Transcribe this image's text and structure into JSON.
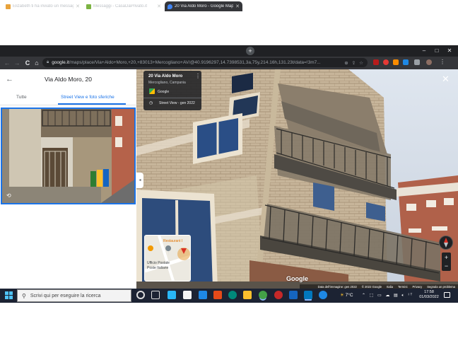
{
  "browser": {
    "tabs": [
      {
        "title": "Elizabeth ti ha inviato un messaggio",
        "active": false
      },
      {
        "title": "Messaggi - CasaDaPrivato.it",
        "active": false
      },
      {
        "title": "20 Via Aldo Moro - Google Maps",
        "active": true
      }
    ],
    "new_tab": "+",
    "minimize": "–",
    "maximize": "□",
    "close": "✕",
    "back": "←",
    "forward": "→",
    "reload": "C",
    "home": "⌂",
    "url_host": "google.it",
    "url_path": "/maps/place/Via+Aldo+Moro,+20,+83013+Mercogliano+AV/@40.9196297,14.7398531,3a,75y,214.16h,131.23t/data=!3m7..."
  },
  "left_panel": {
    "back_icon": "←",
    "title": "Via Aldo Moro, 20",
    "tabs": [
      "Tutte",
      "Street View e foto sferiche"
    ],
    "active_tab": 1,
    "photo_badge": "360"
  },
  "street_view": {
    "card_title": "20 Via Aldo Moro",
    "card_subtitle": "Mercogliano, Campania",
    "card_brand": "Google",
    "card_date": "Street View - gen 2022",
    "card_menu": "⋮",
    "close_icon": "✕",
    "collapse_icon": "◂",
    "minimap_labels": [
      "Restaurant I",
      "Ufficio Postale",
      "Poste Italiane"
    ],
    "zoom_in": "+",
    "zoom_out": "−",
    "google_logo": "Google",
    "attribution": [
      "Data dell'immagine: gen 2022",
      "© 2022 Google",
      "Italia",
      "Termini",
      "Privacy",
      "Segnala un problema"
    ]
  },
  "taskbar": {
    "search_placeholder": "Scrivi qui per eseguire la ricerca",
    "weather": "7°C",
    "time": "17:58",
    "date": "01/03/2022"
  }
}
